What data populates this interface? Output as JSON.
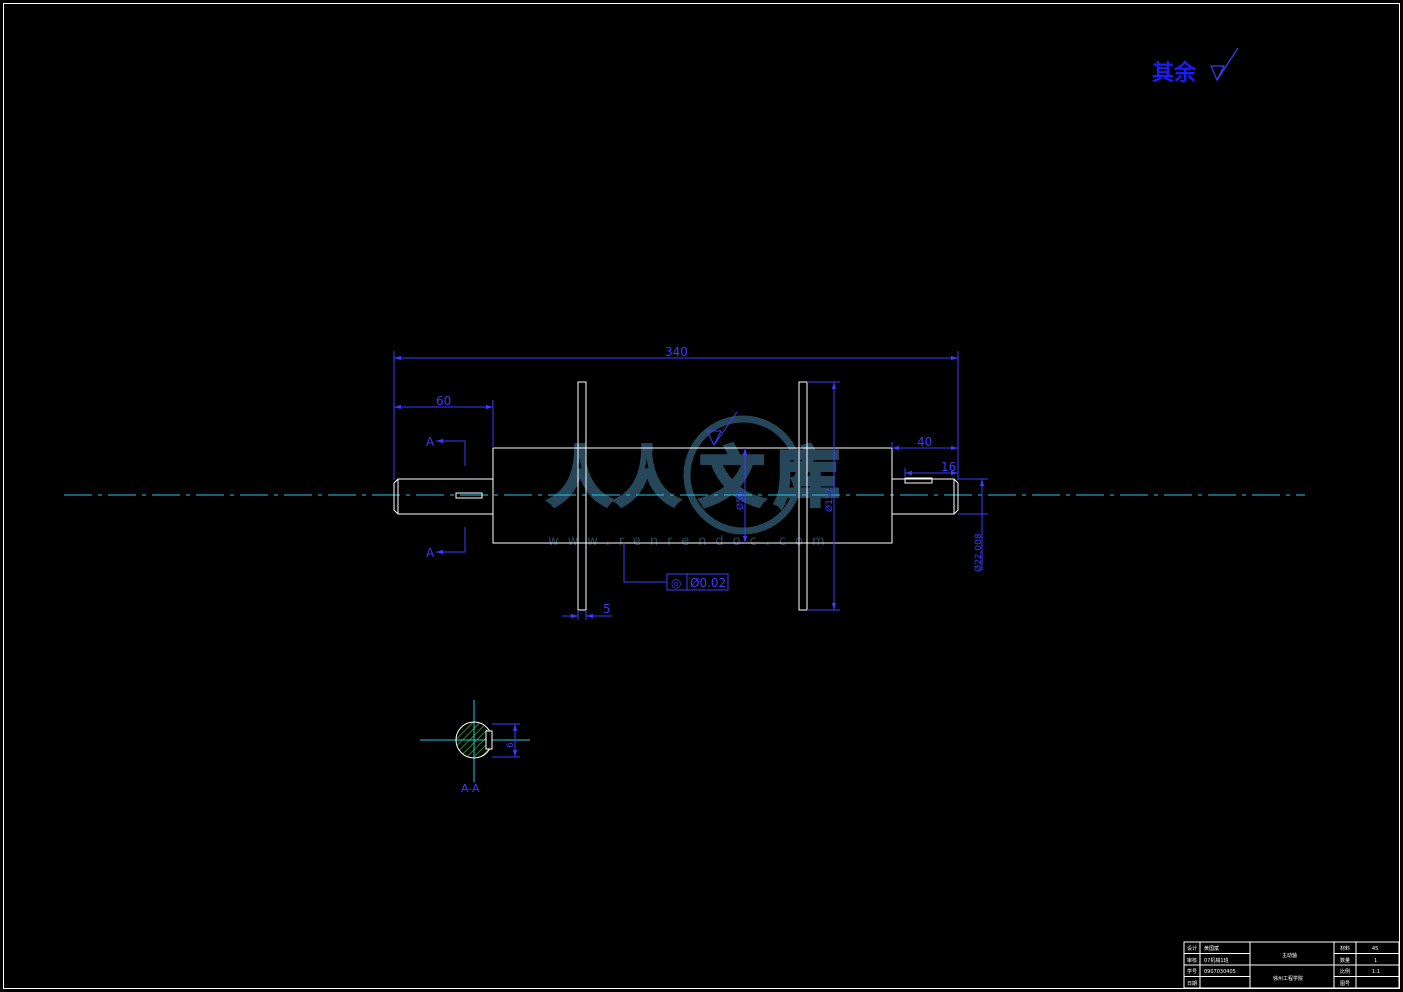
{
  "roughness_note": {
    "text": "其余",
    "symbol_value": ""
  },
  "dimensions": {
    "overall_length": "340",
    "left_shaft_length": "60",
    "right_shaft_length": "40",
    "right_keyway_length": "16",
    "disc_thickness": "5",
    "center_diameter": "Ø50",
    "disc_diameter": "Ø157",
    "right_shaft_diameter": "Ø22.008",
    "section_key_depth": "6"
  },
  "tolerance_frame": {
    "symbol": "◎",
    "value": "Ø0.02"
  },
  "section": {
    "cut_label": "A",
    "view_label": "A-A"
  },
  "title_block": {
    "rows": [
      {
        "role": "设计",
        "name": "黄国斌"
      },
      {
        "role": "审核",
        "name": "07机械1班"
      },
      {
        "role": "学号",
        "name": "0907030405"
      },
      {
        "role": "日期",
        "name": ""
      }
    ],
    "part_name": "主动轴",
    "school": "徐州工程学院",
    "props": [
      {
        "label": "材料",
        "value": "45"
      },
      {
        "label": "数量",
        "value": "1"
      },
      {
        "label": "比例",
        "value": "1:1"
      },
      {
        "label": "图号",
        "value": ""
      }
    ]
  },
  "watermark": {
    "text": "www.renrendoc.com",
    "glyphs": [
      "人",
      "人",
      "文",
      "库"
    ]
  },
  "colors": {
    "outline": "#ffffff",
    "dimension": "#3b3bff",
    "centerline": "#27c6e8",
    "hatch": "#2fd92f",
    "watermark": "#2a4f63"
  }
}
